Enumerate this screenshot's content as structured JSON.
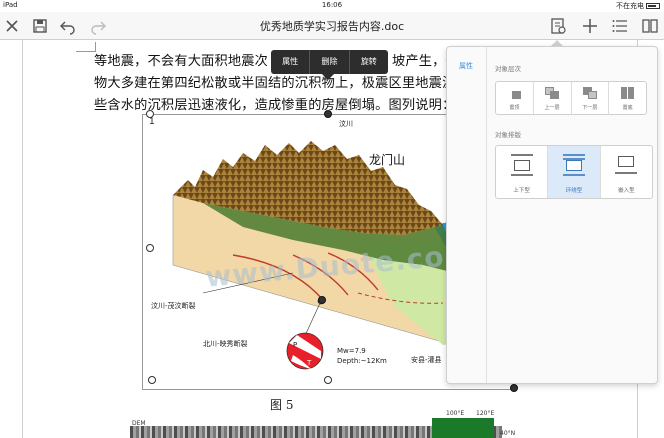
{
  "status_bar": {
    "device": "iPad",
    "time": "16:06",
    "charging": "不在充电"
  },
  "toolbar": {
    "title": "优秀地质学实习报告内容.doc",
    "icons": [
      "close-icon",
      "save-icon",
      "undo-icon",
      "redo-icon",
      "format-icon",
      "add-icon",
      "list-icon",
      "split-view-icon"
    ]
  },
  "document": {
    "lines": [
      "等地震，不会有大面积地震次",
      "坡产生，你",
      "物大多建在第四纪松散或半固结的沉积物上，极震区里地震波",
      "些含水的沉积层迅速液化，造成惨重的房屋倒塌。图列说明："
    ],
    "figure_caption": "图 5"
  },
  "context_menu": {
    "items": [
      "属性",
      "删除",
      "旋转"
    ]
  },
  "figure": {
    "labels": {
      "wenchuan": "汶川",
      "longmenshan": "龙门山",
      "fault1": "汶川-茂汶断裂",
      "fault2": "北川-映秀断裂",
      "fault3": "安县-灌县",
      "magnitude": "Mw=7.9",
      "depth": "Depth:~12Km",
      "p": "P",
      "t": "T",
      "corner_num": "1"
    },
    "watermark": "www.Duote.com"
  },
  "bottom_strip": {
    "lon1": "100°E",
    "lon2": "120°E",
    "lat": "40°N",
    "dem": "DEM"
  },
  "panel": {
    "tab": "属性",
    "layer_section": "对象层次",
    "layer_buttons": [
      "置顶",
      "上一层",
      "下一层",
      "置底"
    ],
    "wrap_section": "对象排版",
    "wrap_buttons": [
      "上下型",
      "环绕型",
      "嵌入型"
    ],
    "active_wrap": "环绕型",
    "accent_color": "#3a8dde"
  }
}
